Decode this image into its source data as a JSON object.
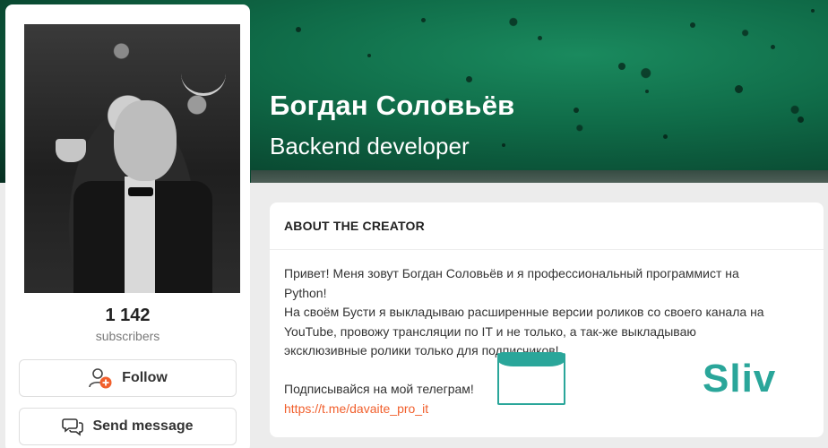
{
  "cover": {
    "name": "Богдан Соловьёв",
    "role": "Backend developer"
  },
  "profile": {
    "subscribers_count": "1 142",
    "subscribers_label": "subscribers",
    "follow_label": "Follow",
    "message_label": "Send message"
  },
  "about": {
    "title": "ABOUT THE CREATOR",
    "line1": "Привет! Меня зовут Богдан Соловьёв и я профессиональный программист на",
    "line2": "Python!",
    "line3": "На своём Бусти я выкладываю расширенные версии роликов со своего канала на",
    "line4": "YouTube, провожу трансляции по IT и не только, а так-же выкладываю",
    "line5": "эксклюзивные ролики только для подписчиков!",
    "line6": "Подписывайся на мой телеграм!",
    "link": "https://t.me/davaite_pro_it"
  },
  "watermark": {
    "text": "Sliv"
  },
  "colors": {
    "accent": "#f15f2c",
    "cover_green": "#0f6a47",
    "watermark": "#2aa69a"
  },
  "icons": {
    "follow": "add-user-icon",
    "message": "chat-bubbles-icon"
  }
}
